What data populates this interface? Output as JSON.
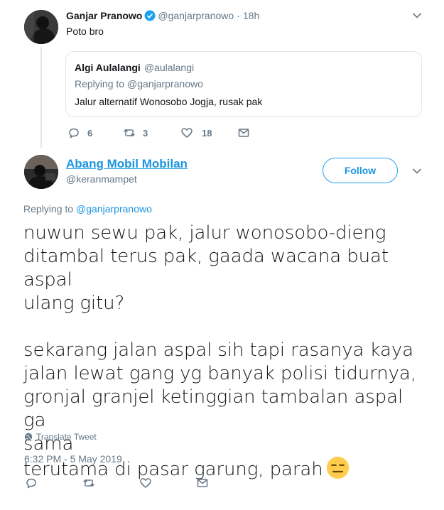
{
  "parent_tweet": {
    "name": "Ganjar Pranowo",
    "handle": "@ganjarpranowo",
    "separator": "·",
    "time": "18h",
    "text": "Poto bro",
    "quoted": {
      "name": "Algi Aulalangi",
      "handle": "@aulalangi",
      "replying_to_prefix": "Replying to",
      "replying_to_handle": "@ganjarpranowo",
      "text": "Jalur alternatif Wonosobo Jogja, rusak pak"
    },
    "actions": {
      "replies": "6",
      "retweets": "3",
      "likes": "18"
    }
  },
  "main_tweet": {
    "name": "Abang Mobil Mobilan",
    "handle": "@keranmampet",
    "follow_label": "Follow",
    "replying_to_prefix": "Replying to",
    "replying_to_handle": "@ganjarpranowo",
    "text": "nuwun sewu pak, jalur wonosobo-dieng\nditambal terus pak, gaada wacana buat aspal\nulang gitu?\n\nsekarang jalan aspal sih tapi rasanya kaya\njalan lewat gang yg banyak polisi tidurnya,\ngronjal granjel ketinggian tambalan aspal ga\nsama\nterutama di pasar garung, parah",
    "translate_label": "Translate Tweet",
    "timestamp": "6:32 PM - 5 May 2019",
    "emoji": "expressionless-face"
  },
  "colors": {
    "link_blue": "#1b95e0",
    "border_blue": "#1da1f2",
    "gray": "#657786",
    "line": "#e1e8ed",
    "verified": "#1da1f2"
  }
}
